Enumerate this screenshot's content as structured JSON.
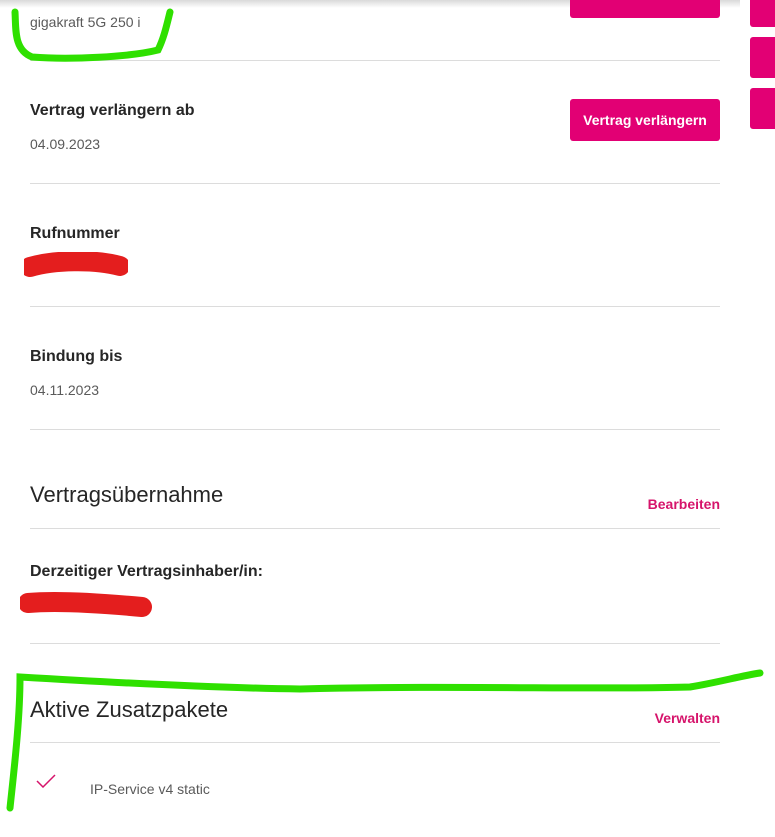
{
  "tariff": {
    "value": "gigakraft 5G 250 i"
  },
  "extend": {
    "label": "Vertrag verlängern ab",
    "date": "04.09.2023",
    "button_label": "Vertrag verlängern"
  },
  "phone": {
    "label": "Rufnummer"
  },
  "binding": {
    "label": "Bindung bis",
    "date": "04.11.2023"
  },
  "takeover": {
    "title": "Vertragsübernahme",
    "edit_label": "Bearbeiten",
    "holder_label": "Derzeitiger Vertragsinhaber/in:"
  },
  "addons": {
    "title": "Aktive Zusatzpakete",
    "manage_label": "Verwalten",
    "items": [
      {
        "name": "IP-Service v4 static"
      }
    ]
  },
  "colors": {
    "brand": "#e20074",
    "link": "#d6146b",
    "redaction": "#e41e1e",
    "annotation": "#2fe000"
  },
  "icons": {
    "check": "check-icon"
  }
}
